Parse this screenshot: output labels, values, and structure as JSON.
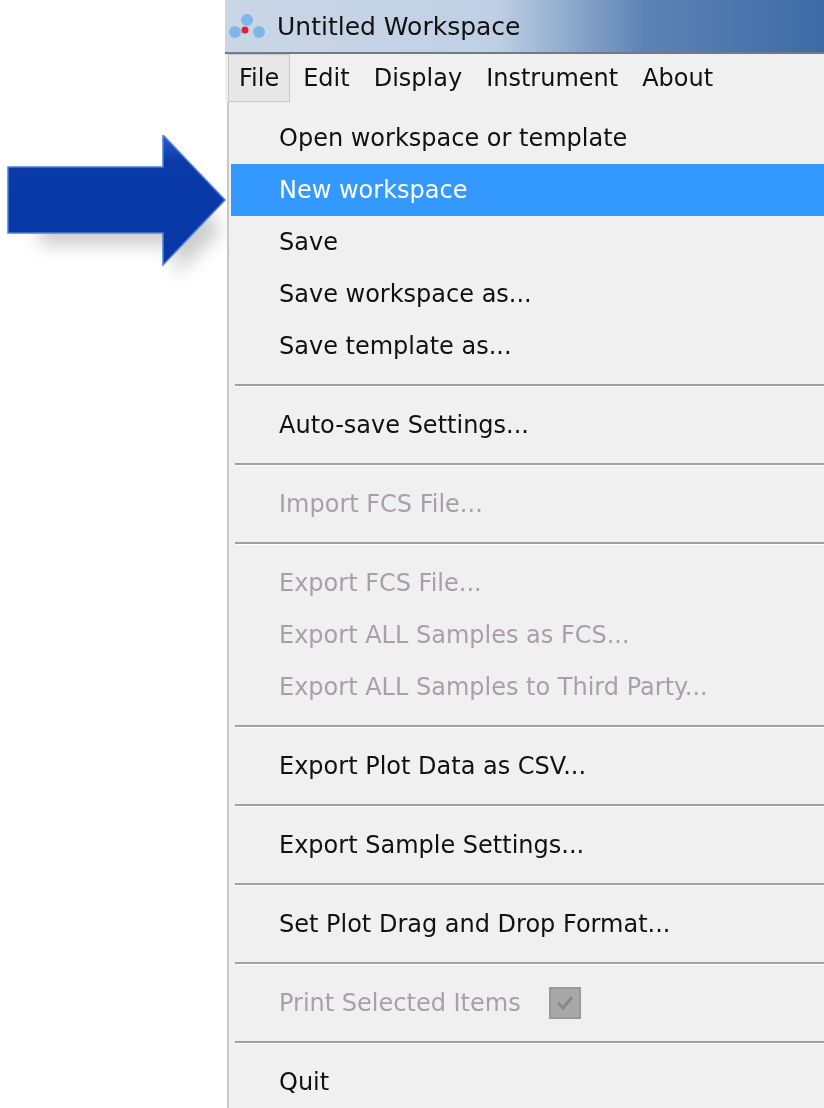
{
  "window": {
    "title": "Untitled Workspace"
  },
  "menubar": [
    {
      "label": "File",
      "selected": true
    },
    {
      "label": "Edit",
      "selected": false
    },
    {
      "label": "Display",
      "selected": false
    },
    {
      "label": "Instrument",
      "selected": false
    },
    {
      "label": "About",
      "selected": false
    }
  ],
  "menu_groups": [
    [
      {
        "kind": "item",
        "label": "Open workspace or template",
        "selected": false,
        "disabled": false
      },
      {
        "kind": "item",
        "label": "New workspace",
        "selected": true,
        "disabled": false
      },
      {
        "kind": "item",
        "label": "Save",
        "selected": false,
        "disabled": false
      },
      {
        "kind": "item",
        "label": "Save workspace as...",
        "selected": false,
        "disabled": false
      },
      {
        "kind": "item",
        "label": "Save template as...",
        "selected": false,
        "disabled": false
      }
    ],
    [
      {
        "kind": "item",
        "label": "Auto-save Settings...",
        "selected": false,
        "disabled": false
      }
    ],
    [
      {
        "kind": "item",
        "label": "Import FCS File...",
        "selected": false,
        "disabled": true
      }
    ],
    [
      {
        "kind": "item",
        "label": "Export FCS File...",
        "selected": false,
        "disabled": true
      },
      {
        "kind": "item",
        "label": "Export ALL Samples as FCS...",
        "selected": false,
        "disabled": true
      },
      {
        "kind": "item",
        "label": "Export ALL Samples to Third Party...",
        "selected": false,
        "disabled": true
      }
    ],
    [
      {
        "kind": "item",
        "label": "Export Plot Data as CSV...",
        "selected": false,
        "disabled": false
      }
    ],
    [
      {
        "kind": "item",
        "label": "Export Sample Settings...",
        "selected": false,
        "disabled": false
      }
    ],
    [
      {
        "kind": "item",
        "label": "Set Plot Drag and Drop Format...",
        "selected": false,
        "disabled": false
      }
    ],
    [
      {
        "kind": "checkbox",
        "label": "Print Selected Items",
        "selected": false,
        "disabled": true,
        "checked": true
      }
    ],
    [
      {
        "kind": "item",
        "label": "Quit",
        "selected": false,
        "disabled": false
      }
    ]
  ]
}
